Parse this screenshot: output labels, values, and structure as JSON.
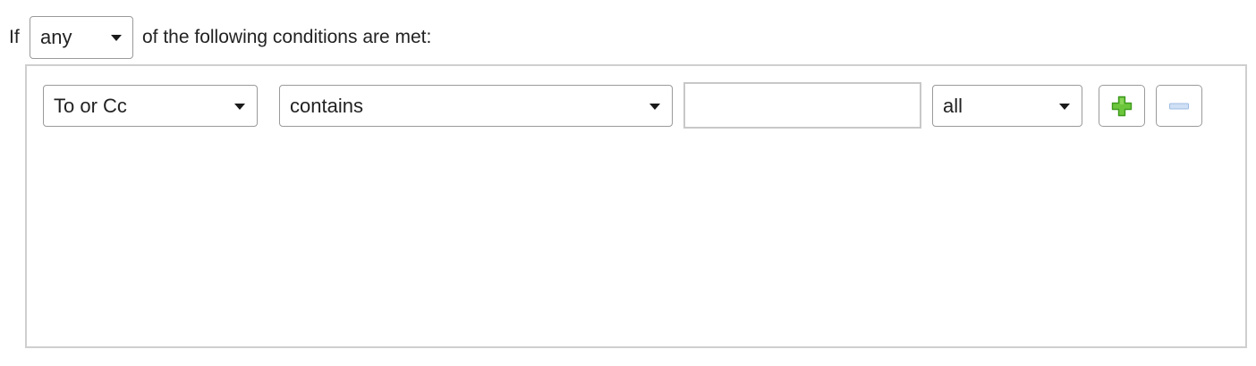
{
  "header": {
    "if_label": "If",
    "match_select": {
      "value": "any"
    },
    "tail_label": "of the following conditions are met:"
  },
  "condition_row": {
    "field_select": {
      "value": "To or Cc"
    },
    "operator_select": {
      "value": "contains"
    },
    "value_input": {
      "value": ""
    },
    "scope_select": {
      "value": "all"
    },
    "add_button": {
      "icon": "plus-icon",
      "color": "#5cb832"
    },
    "remove_button": {
      "icon": "minus-icon",
      "color": "#b9d2ef"
    }
  }
}
